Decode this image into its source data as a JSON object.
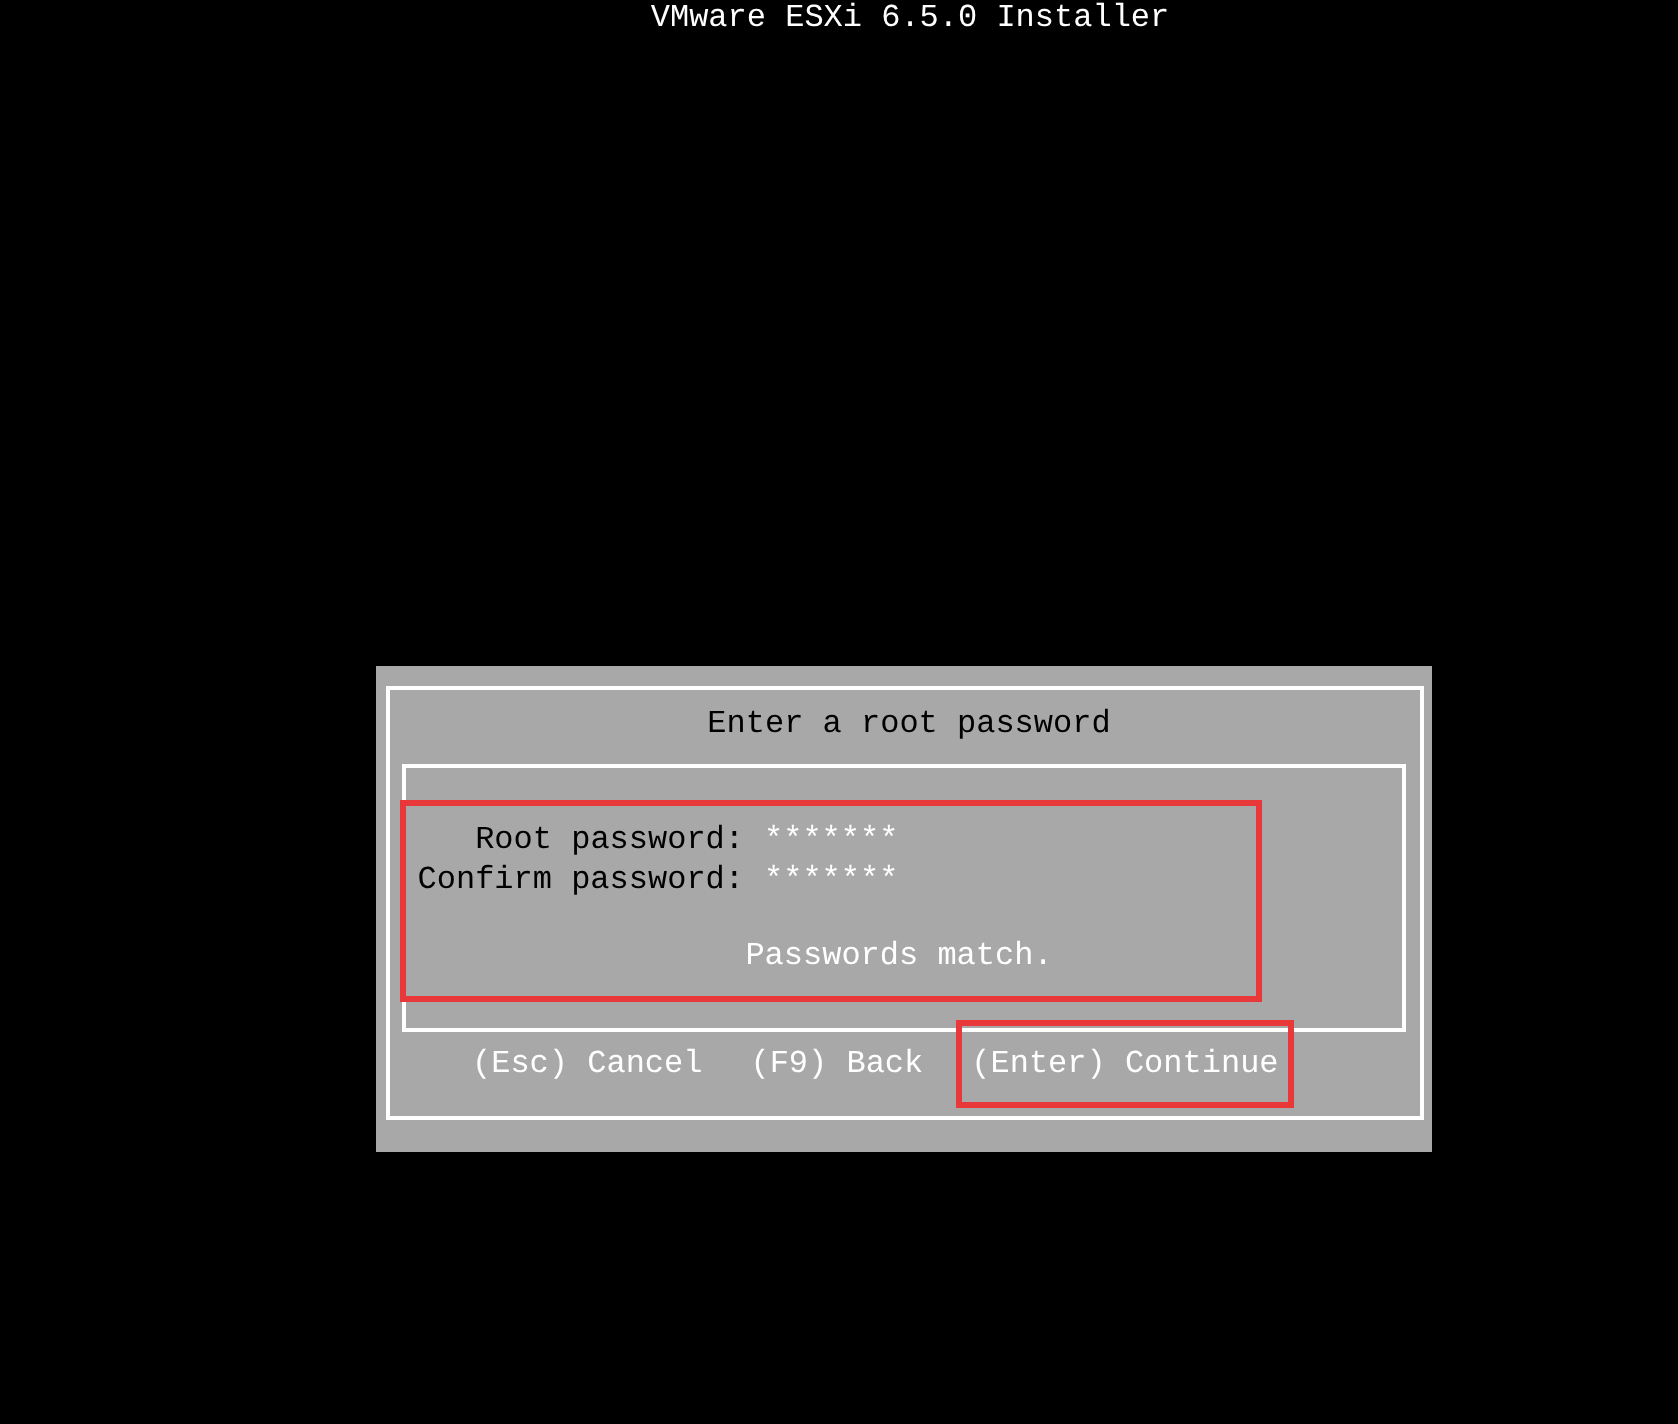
{
  "header": {
    "title": "VMware ESXi 6.5.0 Installer"
  },
  "dialog": {
    "title": "Enter a root password",
    "form": {
      "highlighted": true,
      "fields": [
        {
          "label": "Root password:",
          "value": "*******"
        },
        {
          "label": "Confirm password:",
          "value": "*******"
        }
      ],
      "message": "Passwords match."
    },
    "actions": [
      {
        "label": "(Esc) Cancel",
        "highlighted": false
      },
      {
        "label": "(F9) Back",
        "highlighted": false
      },
      {
        "label": "(Enter) Continue",
        "highlighted": true
      }
    ]
  }
}
